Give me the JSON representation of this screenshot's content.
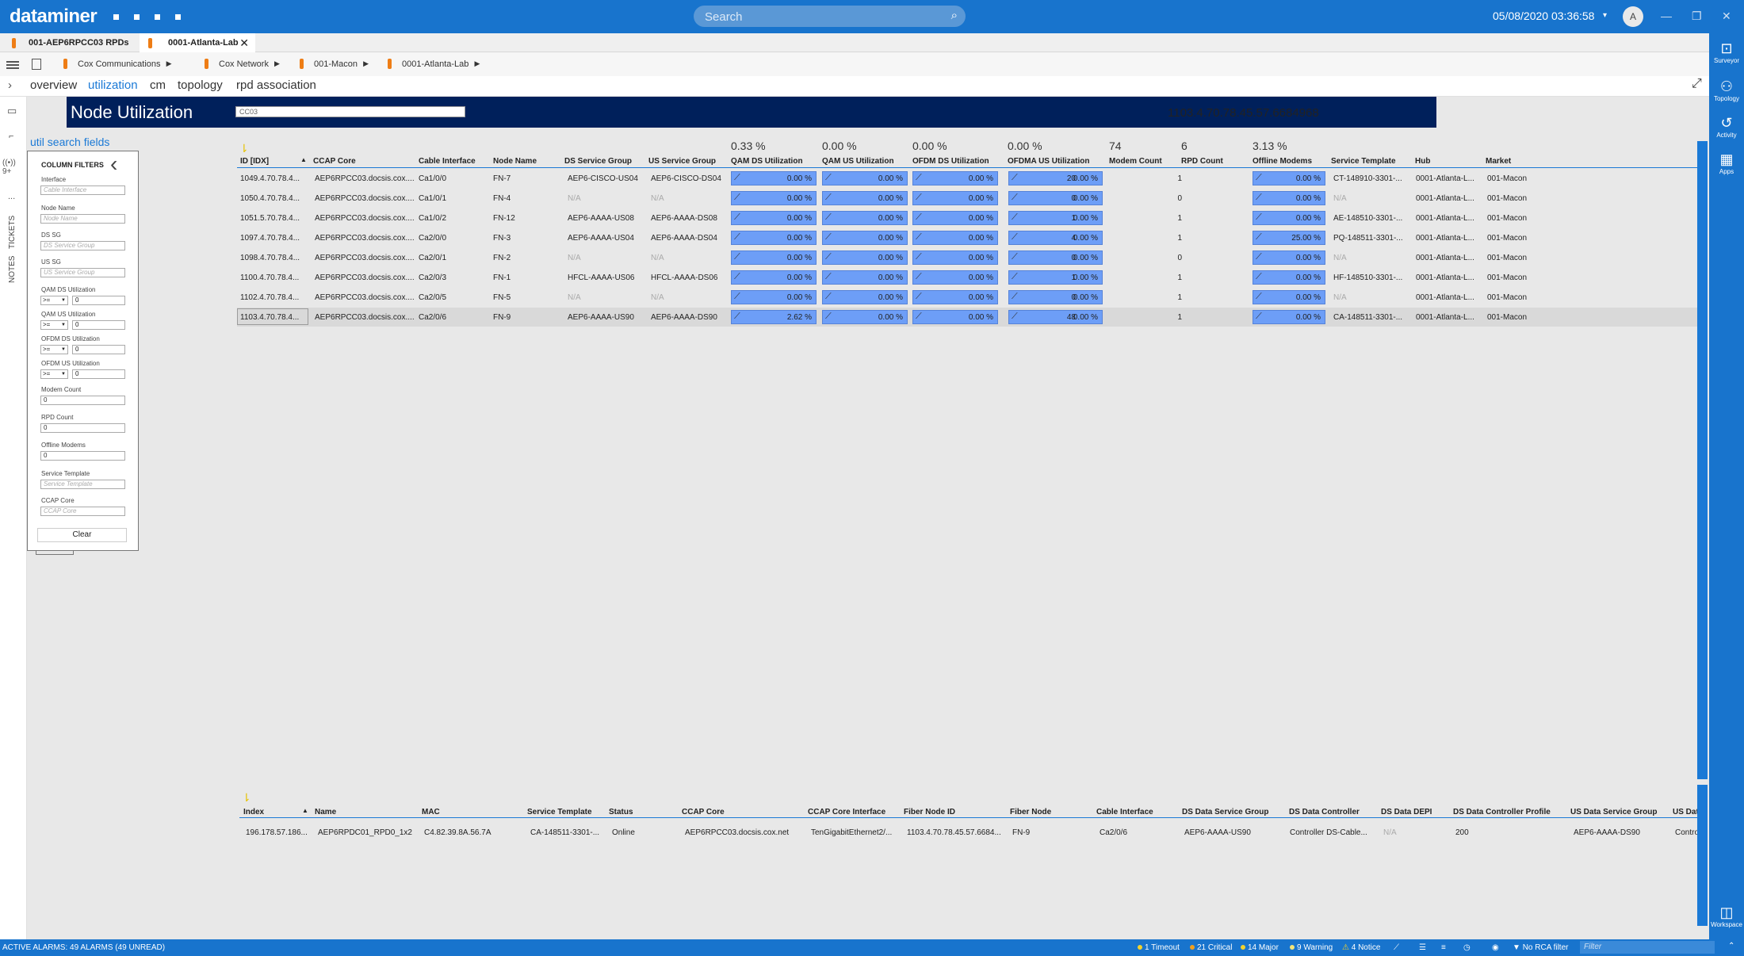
{
  "app": {
    "logo": "dataminer",
    "search_placeholder": "Search",
    "datetime": "05/08/2020 03:36:58",
    "avatar": "A"
  },
  "tabs": [
    {
      "label": "001-AEP6RPCC03 RPDs"
    },
    {
      "label": "0001-Atlanta-Lab"
    }
  ],
  "breadcrumbs": [
    "Cox Communications",
    "Cox Network",
    "001-Macon",
    "0001-Atlanta-Lab"
  ],
  "subtabs": [
    "overview",
    "utilization",
    "cm",
    "topology",
    "rpd association"
  ],
  "left_rail": {
    "tickets": "TICKETS",
    "notes": "NOTES",
    "dots": "...",
    "alarm_count": "9+"
  },
  "right_rail": [
    "Surveyor",
    "Topology",
    "Activity",
    "Apps",
    "Workspace"
  ],
  "banner": {
    "title": "Node Utilization",
    "input_value": "CC03",
    "selected_id": "1103.4.70.78.45.57.6684968"
  },
  "util_link": "util search fields",
  "filters": {
    "title": "COLUMN FILTERS",
    "text_fields": [
      {
        "label": "Interface",
        "placeholder": "Cable Interface"
      },
      {
        "label": "Node Name",
        "placeholder": "Node Name"
      },
      {
        "label": "DS SG",
        "placeholder": "DS Service Group"
      },
      {
        "label": "US SG",
        "placeholder": "US Service Group"
      }
    ],
    "numeric_fields": [
      {
        "label": "QAM DS Utilization",
        "op": ">=",
        "value": "0"
      },
      {
        "label": "QAM US Utilization",
        "op": ">=",
        "value": "0"
      },
      {
        "label": "OFDM DS Utilization",
        "op": ">=",
        "value": "0"
      },
      {
        "label": "OFDM US Utilization",
        "op": ">=",
        "value": "0"
      }
    ],
    "count_fields": [
      {
        "label": "Modem Count",
        "value": "0"
      },
      {
        "label": "RPD Count",
        "value": "0"
      },
      {
        "label": "Offline Modems",
        "value": "0"
      }
    ],
    "text_fields2": [
      {
        "label": "Service Template",
        "placeholder": "Service Template"
      },
      {
        "label": "CCAP Core",
        "placeholder": "CCAP Core"
      }
    ],
    "clear_label": "Clear"
  },
  "node_table": {
    "totals": {
      "qam_ds": "0.33 %",
      "qam_us": "0.00 %",
      "ofdm_ds": "0.00 %",
      "ofdma_us": "0.00 %",
      "modem_count": "74",
      "rpd_count": "6",
      "offline": "3.13 %"
    },
    "headers": [
      "ID [IDX]",
      "CCAP Core",
      "Cable Interface",
      "Node Name",
      "DS Service Group",
      "US Service Group",
      "QAM DS Utilization",
      "QAM US Utilization",
      "OFDM DS Utilization",
      "OFDMA US Utilization",
      "Modem Count",
      "RPD Count",
      "Offline Modems",
      "Service Template",
      "Hub",
      "Market"
    ],
    "rows": [
      {
        "id": "1049.4.70.78.4...",
        "ccap": "AEP6RPCC03.docsis.cox....",
        "iface": "Ca1/0/0",
        "node": "FN-7",
        "ds_sg": "AEP6-CISCO-US04",
        "us_sg": "AEP6-CISCO-DS04",
        "qam_ds": "0.00 %",
        "qam_us": "0.00 %",
        "ofdm_ds": "0.00 %",
        "ofdma_us": "0.00 %",
        "modems": "20",
        "rpd": "1",
        "offline": "0.00 %",
        "template": "CT-148910-3301-...",
        "hub": "0001-Atlanta-L...",
        "market": "001-Macon"
      },
      {
        "id": "1050.4.70.78.4...",
        "ccap": "AEP6RPCC03.docsis.cox....",
        "iface": "Ca1/0/1",
        "node": "FN-4",
        "ds_sg": "N/A",
        "us_sg": "N/A",
        "qam_ds": "0.00 %",
        "qam_us": "0.00 %",
        "ofdm_ds": "0.00 %",
        "ofdma_us": "0.00 %",
        "modems": "0",
        "rpd": "0",
        "offline": "0.00 %",
        "template": "N/A",
        "hub": "0001-Atlanta-L...",
        "market": "001-Macon"
      },
      {
        "id": "1051.5.70.78.4...",
        "ccap": "AEP6RPCC03.docsis.cox....",
        "iface": "Ca1/0/2",
        "node": "FN-12",
        "ds_sg": "AEP6-AAAA-US08",
        "us_sg": "AEP6-AAAA-DS08",
        "qam_ds": "0.00 %",
        "qam_us": "0.00 %",
        "ofdm_ds": "0.00 %",
        "ofdma_us": "0.00 %",
        "modems": "1",
        "rpd": "1",
        "offline": "0.00 %",
        "template": "AE-148510-3301-...",
        "hub": "0001-Atlanta-L...",
        "market": "001-Macon"
      },
      {
        "id": "1097.4.70.78.4...",
        "ccap": "AEP6RPCC03.docsis.cox....",
        "iface": "Ca2/0/0",
        "node": "FN-3",
        "ds_sg": "AEP6-AAAA-US04",
        "us_sg": "AEP6-AAAA-DS04",
        "qam_ds": "0.00 %",
        "qam_us": "0.00 %",
        "ofdm_ds": "0.00 %",
        "ofdma_us": "0.00 %",
        "modems": "4",
        "rpd": "1",
        "offline": "25.00 %",
        "template": "PQ-148511-3301-...",
        "hub": "0001-Atlanta-L...",
        "market": "001-Macon"
      },
      {
        "id": "1098.4.70.78.4...",
        "ccap": "AEP6RPCC03.docsis.cox....",
        "iface": "Ca2/0/1",
        "node": "FN-2",
        "ds_sg": "N/A",
        "us_sg": "N/A",
        "qam_ds": "0.00 %",
        "qam_us": "0.00 %",
        "ofdm_ds": "0.00 %",
        "ofdma_us": "0.00 %",
        "modems": "0",
        "rpd": "0",
        "offline": "0.00 %",
        "template": "N/A",
        "hub": "0001-Atlanta-L...",
        "market": "001-Macon"
      },
      {
        "id": "1100.4.70.78.4...",
        "ccap": "AEP6RPCC03.docsis.cox....",
        "iface": "Ca2/0/3",
        "node": "FN-1",
        "ds_sg": "HFCL-AAAA-US06",
        "us_sg": "HFCL-AAAA-DS06",
        "qam_ds": "0.00 %",
        "qam_us": "0.00 %",
        "ofdm_ds": "0.00 %",
        "ofdma_us": "0.00 %",
        "modems": "1",
        "rpd": "1",
        "offline": "0.00 %",
        "template": "HF-148510-3301-...",
        "hub": "0001-Atlanta-L...",
        "market": "001-Macon"
      },
      {
        "id": "1102.4.70.78.4...",
        "ccap": "AEP6RPCC03.docsis.cox....",
        "iface": "Ca2/0/5",
        "node": "FN-5",
        "ds_sg": "N/A",
        "us_sg": "N/A",
        "qam_ds": "0.00 %",
        "qam_us": "0.00 %",
        "ofdm_ds": "0.00 %",
        "ofdma_us": "0.00 %",
        "modems": "0",
        "rpd": "1",
        "offline": "0.00 %",
        "template": "N/A",
        "hub": "0001-Atlanta-L...",
        "market": "001-Macon"
      },
      {
        "id": "1103.4.70.78.4...",
        "ccap": "AEP6RPCC03.docsis.cox....",
        "iface": "Ca2/0/6",
        "node": "FN-9",
        "ds_sg": "AEP6-AAAA-US90",
        "us_sg": "AEP6-AAAA-DS90",
        "qam_ds": "2.62 %",
        "qam_us": "0.00 %",
        "ofdm_ds": "0.00 %",
        "ofdma_us": "0.00 %",
        "modems": "48",
        "rpd": "1",
        "offline": "0.00 %",
        "template": "CA-148511-3301-...",
        "hub": "0001-Atlanta-L...",
        "market": "001-Macon"
      }
    ]
  },
  "rpd_table": {
    "headers": [
      "Index",
      "Name",
      "MAC",
      "Service Template",
      "Status",
      "CCAP Core",
      "CCAP Core Interface",
      "Fiber Node ID",
      "Fiber Node",
      "Cable Interface",
      "DS Data Service Group",
      "DS Data Controller",
      "DS Data DEPI",
      "DS Data Controller Profile",
      "US Data Service Group",
      "US Dat"
    ],
    "rows": [
      {
        "index": "196.178.57.186...",
        "name": "AEP6RPDC01_RPD0_1x2",
        "mac": "C4.82.39.8A.56.7A",
        "template": "CA-148511-3301-...",
        "status": "Online",
        "ccap": "AEP6RPCC03.docsis.cox.net",
        "ccap_iface": "TenGigabitEthernet2/...",
        "fn_id": "1103.4.70.78.45.57.6684...",
        "fn": "FN-9",
        "cable_iface": "Ca2/0/6",
        "ds_sg": "AEP6-AAAA-US90",
        "ds_ctrl": "Controller DS-Cable...",
        "ds_depi": "N/A",
        "ds_profile": "200",
        "us_sg": "AEP6-AAAA-DS90",
        "us_dat": "Contro"
      }
    ]
  },
  "statusbar": {
    "alarms": "ACTIVE ALARMS: 49 ALARMS (49 UNREAD)",
    "timeout": "1 Timeout",
    "critical": "21 Critical",
    "major": "14 Major",
    "warning": "9 Warning",
    "notice": "4 Notice",
    "rca": "No RCA filter",
    "filter_placeholder": "Filter"
  },
  "colors": {
    "brand": "#1874cd",
    "banner": "#00205b",
    "bar": "#6d9ef7",
    "accent": "#1a79d6",
    "tab_pill": "#ee7d15",
    "critical": "#f0a020"
  }
}
